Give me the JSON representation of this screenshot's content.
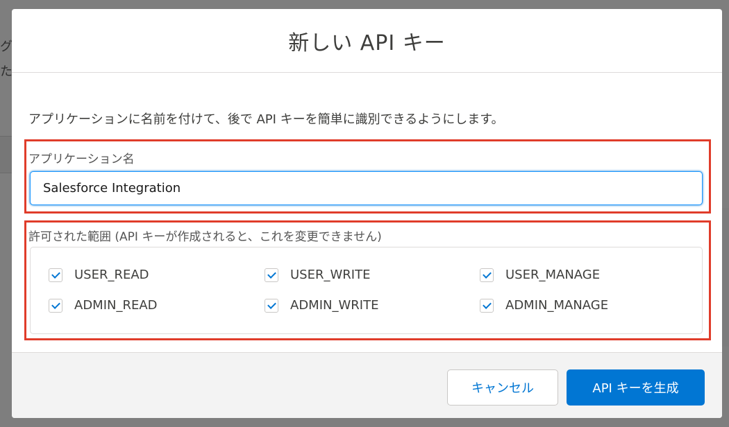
{
  "background": {
    "fragment_lines": [
      "グル",
      "たに"
    ]
  },
  "dialog": {
    "title": "新しい API キー",
    "intro": "アプリケーションに名前を付けて、後で API キーを簡単に識別できるようにします。",
    "app_name": {
      "label": "アプリケーション名",
      "value": "Salesforce Integration"
    },
    "scopes": {
      "label": "許可された範囲 (API キーが作成されると、これを変更できません)",
      "items": [
        {
          "label": "USER_READ",
          "checked": true
        },
        {
          "label": "USER_WRITE",
          "checked": true
        },
        {
          "label": "USER_MANAGE",
          "checked": true
        },
        {
          "label": "ADMIN_READ",
          "checked": true
        },
        {
          "label": "ADMIN_WRITE",
          "checked": true
        },
        {
          "label": "ADMIN_MANAGE",
          "checked": true
        }
      ]
    },
    "footer": {
      "cancel_label": "キャンセル",
      "generate_label": "API キーを生成"
    }
  },
  "colors": {
    "brand_blue": "#0176d3",
    "highlight_red": "#e03c2a"
  }
}
